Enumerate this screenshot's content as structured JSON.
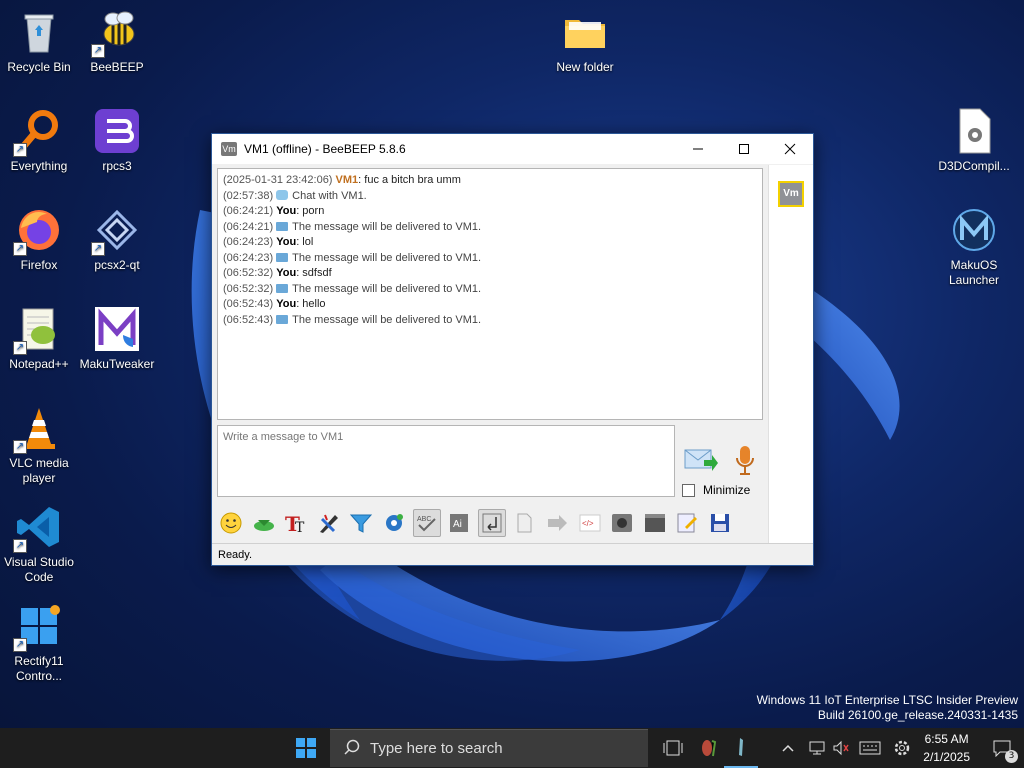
{
  "desktop": {
    "icons": [
      {
        "label": "Recycle Bin"
      },
      {
        "label": "BeeBEEP"
      },
      {
        "label": "New folder"
      },
      {
        "label": "Everything"
      },
      {
        "label": "rpcs3"
      },
      {
        "label": "D3DCompil..."
      },
      {
        "label": "Firefox"
      },
      {
        "label": "pcsx2-qt"
      },
      {
        "label": "MakuOS Launcher"
      },
      {
        "label": "Notepad++"
      },
      {
        "label": "MakuTweaker"
      },
      {
        "label": "VLC media player"
      },
      {
        "label": "Visual Studio Code"
      },
      {
        "label": "Rectify11 Contro..."
      }
    ]
  },
  "window": {
    "app_icon_text": "Vm",
    "title": "VM1 (offline) - BeeBEEP 5.8.6",
    "chat": [
      {
        "ts": "(2025-01-31 23:42:06)",
        "who": "VM1",
        "text": ": fuc a bitch bra         umm"
      },
      {
        "ts": "(02:57:38)",
        "sys": "Chat with VM1."
      },
      {
        "ts": "(06:24:21)",
        "who": "You",
        "text": ": porn"
      },
      {
        "ts": "(06:24:21)",
        "sys": "The message will be delivered to VM1."
      },
      {
        "ts": "(06:24:23)",
        "who": "You",
        "text": ": lol"
      },
      {
        "ts": "(06:24:23)",
        "sys": "The message will be delivered to VM1."
      },
      {
        "ts": "(06:52:32)",
        "who": "You",
        "text": ": sdfsdf"
      },
      {
        "ts": "(06:52:32)",
        "sys": "The message will be delivered to VM1."
      },
      {
        "ts": "(06:52:43)",
        "who": "You",
        "text": ": hello"
      },
      {
        "ts": "(06:52:43)",
        "sys": "The message will be delivered to VM1."
      }
    ],
    "sidebar_user": "Vm",
    "compose_placeholder": "Write a message to VM1",
    "minimize_label": "Minimize",
    "status": "Ready."
  },
  "watermark": {
    "line1": "Windows 11 IoT Enterprise LTSC Insider Preview",
    "line2": "Build 26100.ge_release.240331-1435"
  },
  "taskbar": {
    "search_placeholder": "Type here to search",
    "time": "6:55 AM",
    "date": "2/1/2025",
    "notification_count": "3"
  }
}
